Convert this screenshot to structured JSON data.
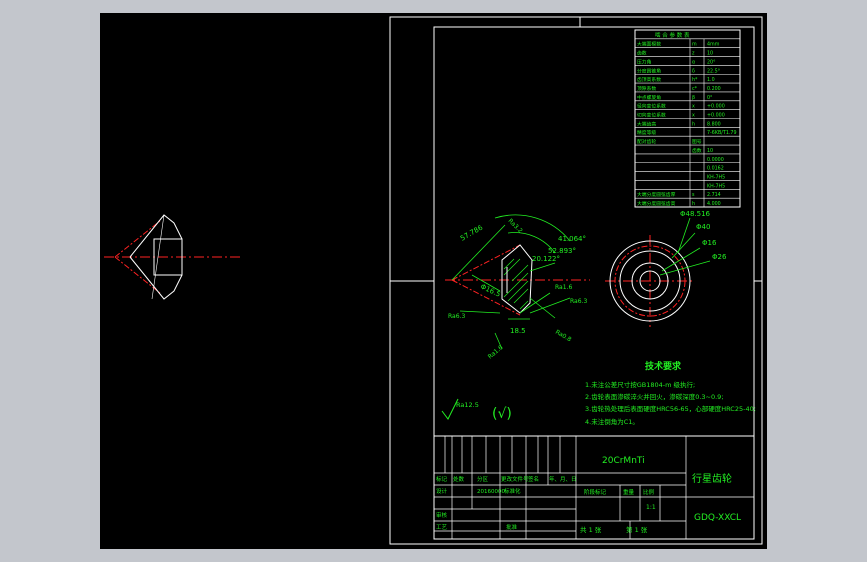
{
  "param_table": {
    "header": "啮 合 参 数 表",
    "rows": [
      {
        "name": "大端面模数",
        "sym": "m",
        "val": "4mm"
      },
      {
        "name": "齿数",
        "sym": "z",
        "val": "10"
      },
      {
        "name": "压力角",
        "sym": "α",
        "val": "20°"
      },
      {
        "name": "分度圆锥角",
        "sym": "δ",
        "val": "22.5°"
      },
      {
        "name": "齿顶高系数",
        "sym": "h*",
        "val": "1.0"
      },
      {
        "name": "顶隙系数",
        "sym": "c*",
        "val": "0.200"
      },
      {
        "name": "中点螺旋角",
        "sym": "β",
        "val": "0°"
      },
      {
        "name": "径向变位系数",
        "sym": "x",
        "val": "+0.000"
      },
      {
        "name": "切向变位系数",
        "sym": "x",
        "val": "+0.000"
      },
      {
        "name": "大端齿高",
        "sym": "h",
        "val": "8.800"
      },
      {
        "name": "精度等级",
        "sym": "",
        "val": "7-6KB/T1.79"
      },
      {
        "name": "配对齿轮",
        "sym": "图号",
        "val": ""
      },
      {
        "name": "",
        "sym": "齿数",
        "val": "10"
      },
      {
        "name": "",
        "sym": "",
        "val": "0.0000"
      },
      {
        "name": "",
        "sym": "",
        "val": "0.0162"
      },
      {
        "name": "",
        "sym": "",
        "val": "KH-7H5"
      },
      {
        "name": "",
        "sym": "",
        "val": "KH-7H5"
      },
      {
        "name": "大端分度圆弦齿厚",
        "sym": "s",
        "val": "2.714"
      },
      {
        "name": "大端分度圆弦齿高",
        "sym": "h",
        "val": "4.000"
      }
    ]
  },
  "dimensions": {
    "d1": "57.786",
    "d2": "41.064°",
    "d3": "52.893°",
    "d4": "20.122°",
    "d5": "Φ16.5",
    "d6": "18.5",
    "phi_outer": "Φ48.516",
    "phi_40": "Φ40",
    "phi_16": "Φ16",
    "phi_26": "Φ26",
    "ra1": "Ra3.2",
    "ra2": "Ra6.3",
    "ra3": "Ra1.6",
    "ra4": "Ra6.3",
    "ra5": "Ra0.8",
    "ra6": "Ra1.6",
    "rough_general": "Ra12.5"
  },
  "tech_req": {
    "title": "技术要求",
    "items": [
      "1.未注公差尺寸按GB1804-m 级执行;",
      "2.齿轮表面渗碳淬火并回火，渗碳深度0.3~0.9;",
      "3.齿轮热处理后表面硬度HRC56-65，心部硬度HRC25-40;",
      "4.未注倒角为C1。"
    ]
  },
  "title_block": {
    "material": "20CrMnTi",
    "part_name": "行星齿轮",
    "drawing_no": "GDQ-XXCL",
    "row_labels": [
      "标记",
      "处数",
      "分区",
      "更改文件号",
      "签名",
      "年、月、日"
    ],
    "design": "设计",
    "std_label": "标准化",
    "std_no": "20160000",
    "review": "审核",
    "process": "工艺",
    "approve": "批准",
    "stage": "阶段标记",
    "weight": "重量",
    "scale_label": "比例",
    "scale": "1:1",
    "sheets": "共 1 张",
    "sheet_no": "第 1 张"
  },
  "colors": {
    "bg": "#000000",
    "frame": "#ffffff",
    "geom": "#ffffff",
    "dim": "#22ee22",
    "center": "#ff2222",
    "hatch": "#22ee22"
  }
}
